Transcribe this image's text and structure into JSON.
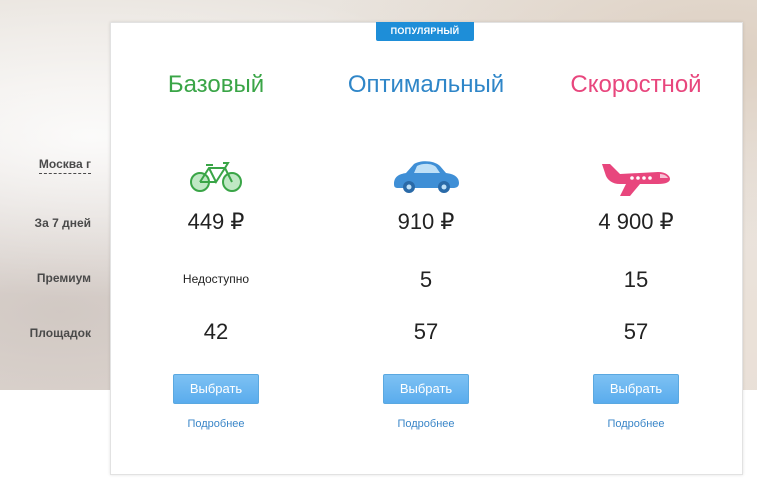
{
  "badge": "ПОПУЛЯРНЫЙ",
  "rows": {
    "city": "Москва г",
    "period": "За 7 дней",
    "premium": "Премиум",
    "sites": "Площадок"
  },
  "plans": [
    {
      "name": "Базовый",
      "color": "#3aa547",
      "icon": "bicycle-icon",
      "price": "449 ₽",
      "premium": "Недоступно",
      "sites": "42",
      "button": "Выбрать",
      "more": "Подробнее"
    },
    {
      "name": "Оптимальный",
      "color": "#2f86c8",
      "icon": "car-icon",
      "price": "910 ₽",
      "premium": "5",
      "sites": "57",
      "button": "Выбрать",
      "more": "Подробнее"
    },
    {
      "name": "Скоростной",
      "color": "#e8467d",
      "icon": "airplane-icon",
      "price": "4 900 ₽",
      "premium": "15",
      "sites": "57",
      "button": "Выбрать",
      "more": "Подробнее"
    }
  ]
}
